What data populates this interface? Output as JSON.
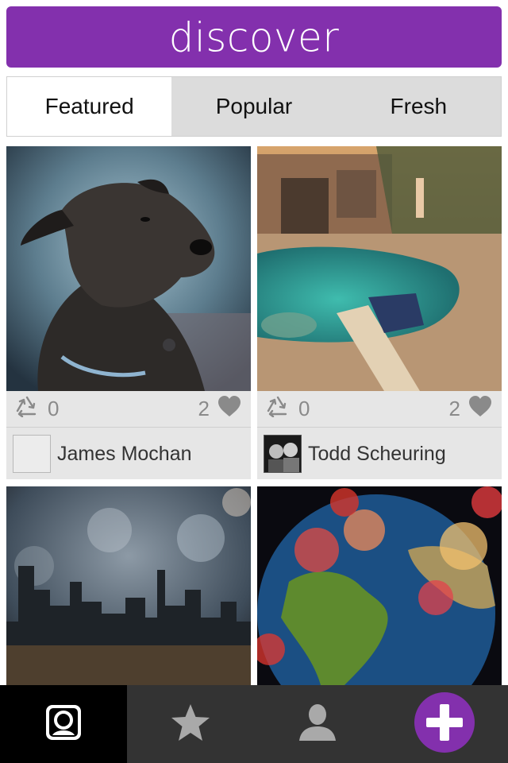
{
  "header": {
    "title": "discover"
  },
  "tabs": [
    {
      "label": "Featured",
      "active": true
    },
    {
      "label": "Popular",
      "active": false
    },
    {
      "label": "Fresh",
      "active": false
    }
  ],
  "posts": [
    {
      "subject": "dog",
      "reposts": "0",
      "likes": "2",
      "author": "James Mochan",
      "avatar": "empty"
    },
    {
      "subject": "pool",
      "reposts": "0",
      "likes": "2",
      "author": "Todd Scheuring",
      "avatar": "photo"
    },
    {
      "subject": "city-skyline"
    },
    {
      "subject": "earth"
    }
  ],
  "tabbar": {
    "items": [
      {
        "icon": "profile-frame-icon",
        "active": true
      },
      {
        "icon": "star-icon",
        "active": false
      },
      {
        "icon": "person-icon",
        "active": false
      },
      {
        "icon": "plus-icon",
        "active": false
      }
    ]
  },
  "colors": {
    "brand": "#8330ad",
    "tabbar": "#333333",
    "meta": "#8a8a8a"
  }
}
